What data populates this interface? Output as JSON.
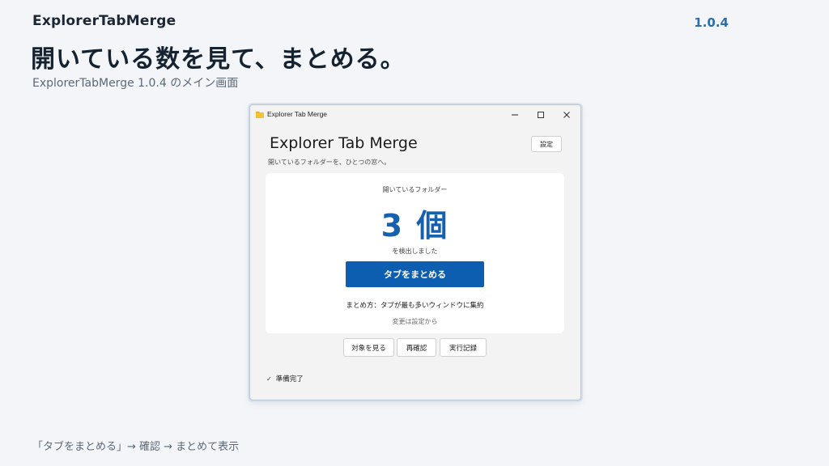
{
  "slide": {
    "title": "ExplorerTabMerge",
    "version": "1.0.4",
    "headline": "開いている数を見て、まとめる。",
    "subtitle": "ExplorerTabMerge 1.0.4 のメイン画面",
    "footer": "「タブをまとめる」→ 確認 → まとめて表示"
  },
  "window": {
    "title": "Explorer Tab Merge",
    "icon": "folder-icon",
    "controls": [
      "minimize-icon",
      "maximize-icon",
      "close-icon"
    ]
  },
  "app": {
    "title": "Explorer Tab Merge",
    "subtitle": "開いているフォルダーを、ひとつの窓へ。",
    "settings_label": "設定"
  },
  "card": {
    "label": "開いているフォルダー",
    "count": "3 個",
    "detected": "を検出しました",
    "merge_label": "タブをまとめる",
    "method": "まとめ方：タブが最も多いウィンドウに集約",
    "change_hint": "変更は設定から"
  },
  "actions": {
    "targets_label": "対象を見る",
    "recheck_label": "再確認",
    "history_label": "実行記録"
  },
  "status": {
    "icon": "check-icon",
    "text": "準備完了"
  },
  "colors": {
    "accent": "#0d5eb0",
    "count": "#1660b0",
    "version": "#2a6fb0",
    "background": "#f3f5f9"
  }
}
